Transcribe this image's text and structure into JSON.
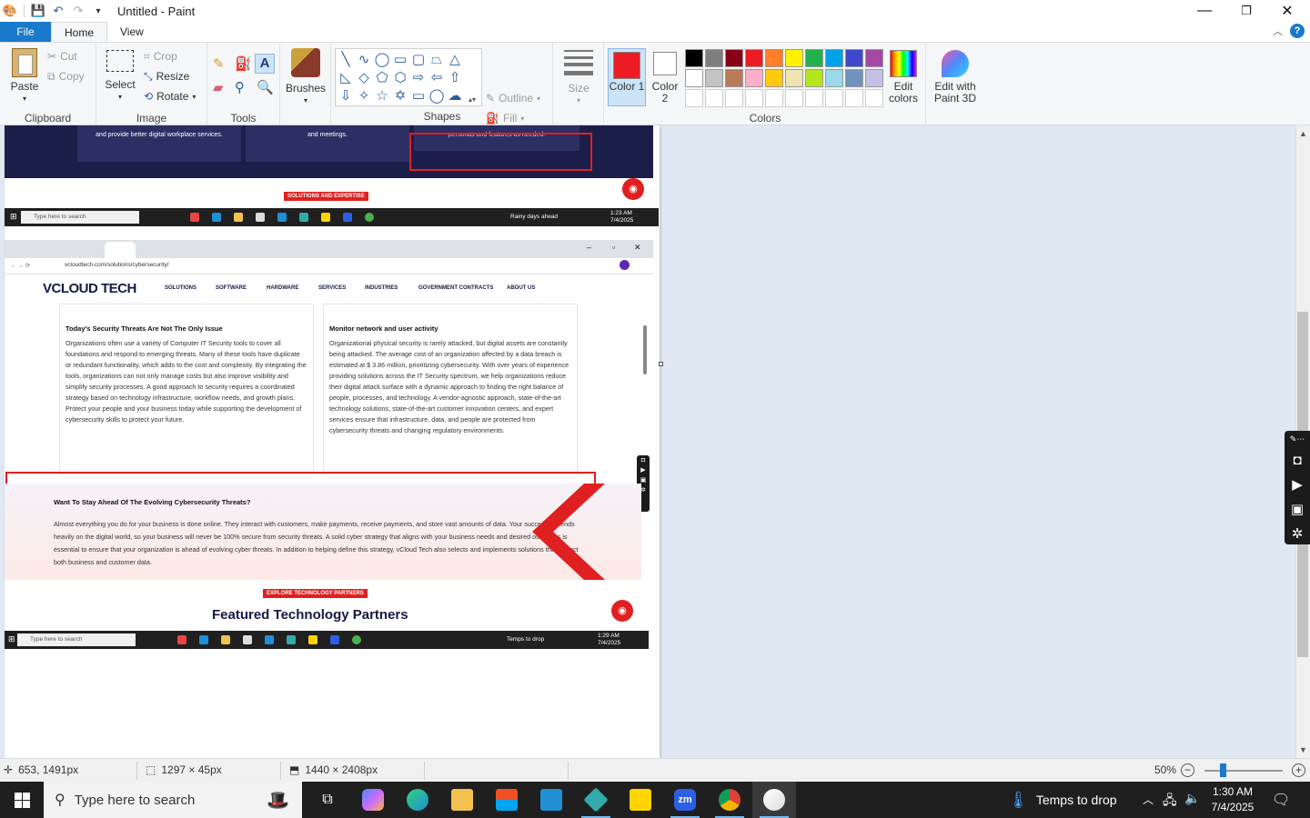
{
  "window": {
    "title": "Untitled - Paint",
    "minimize": "—",
    "maximize": "❐",
    "close": "✕"
  },
  "tabs": {
    "file": "File",
    "home": "Home",
    "view": "View"
  },
  "ribbon": {
    "clipboard": {
      "label": "Clipboard",
      "paste": "Paste",
      "cut": "Cut",
      "copy": "Copy"
    },
    "image": {
      "label": "Image",
      "select": "Select",
      "crop": "Crop",
      "resize": "Resize",
      "rotate": "Rotate"
    },
    "tools": {
      "label": "Tools"
    },
    "brushes": {
      "label": "Brushes"
    },
    "shapes": {
      "label": "Shapes",
      "outline": "Outline",
      "fill": "Fill"
    },
    "size": {
      "label": "Size"
    },
    "colors": {
      "label": "Colors",
      "color1": "Color 1",
      "color2": "Color 2",
      "edit": "Edit colors",
      "paint3d": "Edit with Paint 3D",
      "color1_value": "#ed1c24",
      "palette": [
        "#000000",
        "#7f7f7f",
        "#880015",
        "#ed1c24",
        "#ff7f27",
        "#fff200",
        "#22b14c",
        "#00a2e8",
        "#3f48cc",
        "#a349a4",
        "#ffffff",
        "#c3c3c3",
        "#b97a57",
        "#ffaec9",
        "#ffc90e",
        "#efe4b0",
        "#b5e61d",
        "#99d9ea",
        "#7092be",
        "#c8bfe7",
        "#ffffff",
        "#ffffff",
        "#ffffff",
        "#ffffff",
        "#ffffff",
        "#ffffff",
        "#ffffff",
        "#ffffff",
        "#ffffff",
        "#ffffff"
      ]
    }
  },
  "canvas_content": {
    "dark_cards": [
      "and provide better digital workplace services.",
      "and meetings.",
      "personas and features as needed."
    ],
    "pill1": "SOLUTIONS AND EXPERTISE",
    "mini_taskbar1": {
      "search": "Type here to search",
      "weather": "Rainy days ahead",
      "time": "1:23 AM",
      "date": "7/4/2025"
    },
    "url": "vcloudtech.com/solutions/cybersecurity/",
    "logo": "VCLOUD TECH",
    "nav": [
      "SOLUTIONS",
      "SOFTWARE",
      "HARDWARE",
      "SERVICES",
      "INDUSTRIES",
      "GOVERNMENT CONTRACTS",
      "ABOUT US"
    ],
    "card1": {
      "title": "Today's Security Threats Are Not The Only Issue",
      "body": "Organizations often use a variety of Computer IT Security tools to cover all foundations and respond to emerging threats. Many of these tools have duplicate or redundant functionality, which adds to the cost and complexity. By integrating the tools, organizations can not only manage costs but also improve visibility and simplify security processes. A good approach to security requires a coordinated strategy based on technology infrastructure, workflow needs, and growth plans. Protect your people and your business today while supporting the development of cybersecurity skills to protect your future."
    },
    "card2": {
      "title": "Monitor network and user activity",
      "body": "Organizational physical security is rarely attacked, but digital assets are constantly being attacked. The average cost of an organization affected by a data breach is estimated at $ 3.86 million, prioritizing cybersecurity. With over years of experience providing solutions across the IT Security spectrum, we help organizations reduce their digital attack surface with a dynamic approach to finding the right balance of people, processes, and technology. A vendor-agnostic approach, state-of-the-art technology solutions, state-of-the-art customer innovation centers, and expert services ensure that infrastructure, data, and people are protected from cybersecurity threats and changing regulatory environments."
    },
    "section": {
      "title": "Want To Stay Ahead Of The Evolving Cybersecurity Threats?",
      "body": "Almost everything you do for your business is done online. They interact with customers, make payments, receive payments, and store vast amounts of data. Your success depends heavily on the digital world, so your business will never be 100% secure from security threats. A solid cyber strategy that aligns with your business needs and desired outcomes is essential to ensure that your organization is ahead of evolving cyber threats. In addition to helping define this strategy, vCloud Tech also selects and implements solutions that protect both business and customer data."
    },
    "pill2": "EXPLORE TECHNOLOGY PARTNERS",
    "featured": "Featured Technology Partners",
    "mini_taskbar2": {
      "search": "Type here to search",
      "weather": "Temps to drop",
      "time": "1:29 AM",
      "date": "7/4/2025"
    }
  },
  "statusbar": {
    "cursor": "653, 1491px",
    "selection": "1297 × 45px",
    "image_size": "1440 × 2408px",
    "zoom": "50%"
  },
  "taskbar": {
    "search_placeholder": "Type here to search",
    "weather": "Temps to drop",
    "time": "1:30 AM",
    "date": "7/4/2025"
  }
}
